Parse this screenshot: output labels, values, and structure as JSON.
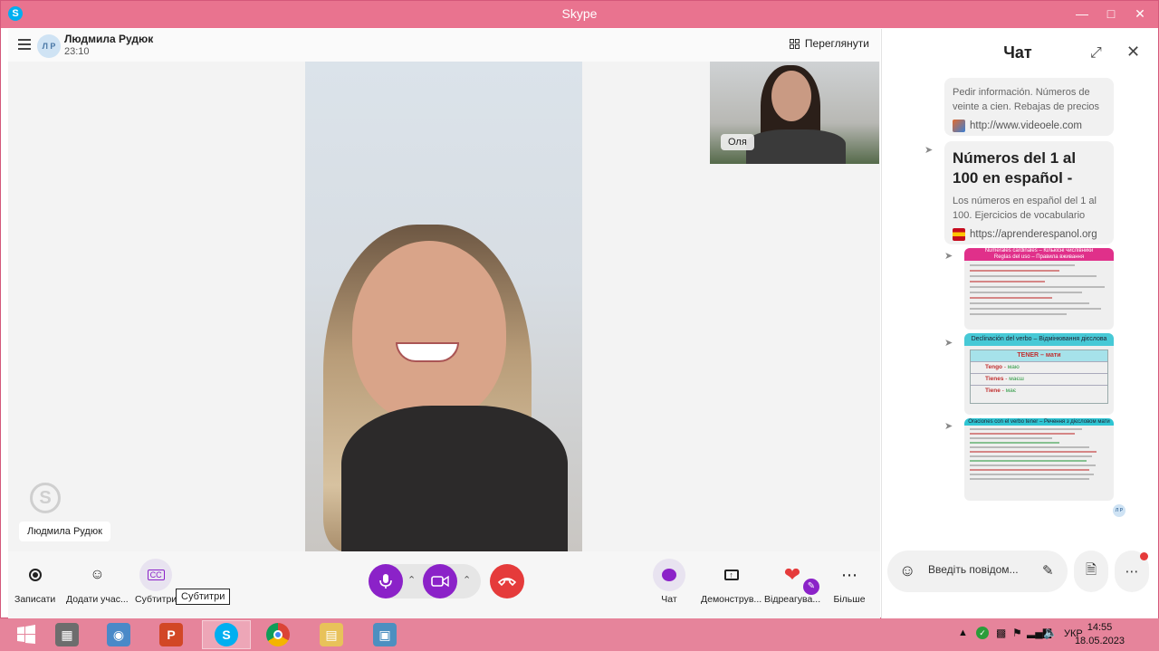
{
  "window": {
    "title": "Skype",
    "app_icon": "S"
  },
  "call": {
    "caller_name": "Людмила Рудюк",
    "caller_initials": "Л Р",
    "duration": "23:10",
    "view_label": "Переглянути",
    "main_name_tag": "Людмила Рудюк",
    "pip_name": "Оля"
  },
  "toolbar": {
    "record_label": "Записати",
    "add_people_label": "Додати учас...",
    "subtitles_label": "Субтитри",
    "subtitles_tooltip": "Субтитри",
    "chat_label": "Чат",
    "share_label": "Демонструв...",
    "react_label": "Відреагува...",
    "more_label": "Більше"
  },
  "chat": {
    "title": "Чат",
    "card1": {
      "desc": "Pedir información. Números de veinte a cien. Rebajas de precios",
      "url": "http://www.videoele.com"
    },
    "card2": {
      "title": "Números del 1 al 100 en español -",
      "desc": "Los números en español del 1 al 100. Ejercicios de vocabulario",
      "url": "https://aprenderespanol.org"
    },
    "img1": {
      "band_line1": "Numerales cardinales – Кількісні числівники",
      "band_line2": "Reglas del uso – Правила вживання"
    },
    "img2": {
      "band": "Declinación del verbo – Відмінювання дієслова",
      "table_header": "TENER – мати",
      "rows": [
        {
          "es": "Tengo",
          "uk": "маю"
        },
        {
          "es": "Tienes",
          "uk": "маєш"
        },
        {
          "es": "Tiene",
          "uk": "має"
        }
      ]
    },
    "img3": {
      "band": "Oraciones con el verbo tener – Речення з дієсловом мати"
    },
    "read_initials": "Л Р",
    "input_placeholder": "Введіть повідом..."
  },
  "taskbar": {
    "language": "УКР",
    "time": "14:55",
    "date": "18.05.2023"
  },
  "colors": {
    "accent_purple": "#8b22c8",
    "hangup_red": "#e53b3b",
    "title_pink": "#e9738f"
  }
}
